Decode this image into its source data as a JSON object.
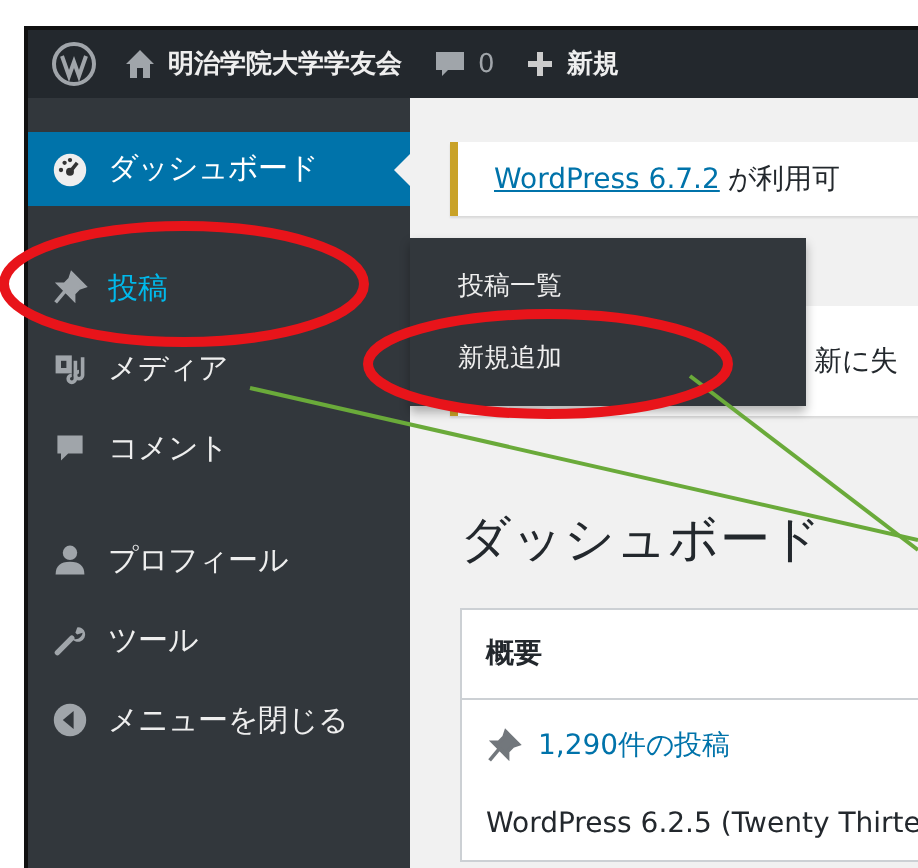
{
  "admin_bar": {
    "site_name": "明治学院大学学友会",
    "comment_count": "0",
    "new_label": "新規"
  },
  "sidebar": {
    "groups": [
      [
        {
          "label": "ダッシュボード",
          "selected": true,
          "hovered": false
        },
        {
          "label": "投稿",
          "selected": false,
          "hovered": true
        },
        {
          "label": "メディア",
          "selected": false,
          "hovered": false
        },
        {
          "label": "コメント",
          "selected": false,
          "hovered": false
        }
      ],
      [
        {
          "label": "プロフィール",
          "selected": false,
          "hovered": false
        },
        {
          "label": "ツール",
          "selected": false,
          "hovered": false
        },
        {
          "label": "メニューを閉じる",
          "selected": false,
          "hovered": false
        }
      ]
    ]
  },
  "flyout": {
    "items": [
      {
        "label": "投稿一覧"
      },
      {
        "label": "新規追加"
      }
    ]
  },
  "notices": [
    {
      "link": "WordPress 6.7.2",
      "text": "が利用可"
    },
    {
      "text": "新に失"
    }
  ],
  "heading": "ダッシュボード",
  "widget": {
    "title": "概要",
    "posts_link": "1,290件の投稿",
    "version": "WordPress 6.2.5 (Twenty Thirte"
  }
}
